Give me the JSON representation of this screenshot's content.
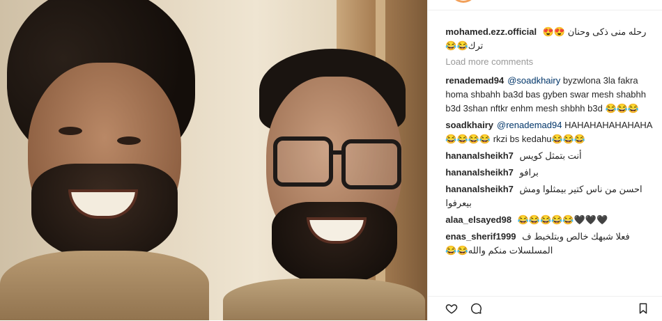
{
  "post": {
    "author": "mohamed.ezz.official",
    "caption": "رحله منى ذكى وحنان 😍😍 ترك😂😂"
  },
  "load_more": "Load more comments",
  "comments": [
    {
      "user": "renademad94",
      "mention": "@soadkhairy",
      "text": " byzwlona 3la fakra homa shbahh ba3d bas gyben swar mesh shabhh b3d 3shan nftkr enhm mesh shbhh b3d 😂😂😂"
    },
    {
      "user": "soadkhairy",
      "mention": "@renademad94",
      "text": " HAHAHAHAHAHAHA 😂😂😂😂 rkzi bs kedahu😂😂😂"
    },
    {
      "user": "hananalsheikh7",
      "mention": "",
      "text": "أنت بتمثل كويس"
    },
    {
      "user": "hananalsheikh7",
      "mention": "",
      "text": "برافو"
    },
    {
      "user": "hananalsheikh7",
      "mention": "",
      "text": "احسن من ناس كتير بيمثلوا ومش بيعرفوا"
    },
    {
      "user": "alaa_elsayed98",
      "mention": "",
      "text": "😂😂😂😂😂🖤🖤🖤"
    },
    {
      "user": "enas_sherif1999",
      "mention": "",
      "text": "فعلا شبهك خالص وبتلخبط ف المسلسلات منكم والله😂😂"
    }
  ],
  "icons": {
    "like": "heart-icon",
    "comment": "comment-icon",
    "save": "bookmark-icon"
  },
  "colors": {
    "mention": "#003569",
    "muted": "#999999",
    "ring": "#f2a05a"
  }
}
